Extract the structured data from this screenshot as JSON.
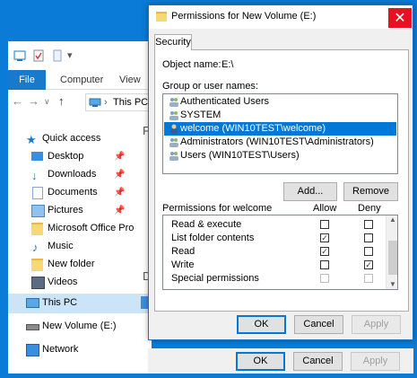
{
  "explorer": {
    "ribbon_tabs": [
      "File",
      "Computer",
      "View"
    ],
    "address": "This PC",
    "partial_headers": [
      "F",
      "D"
    ],
    "sidebar": [
      {
        "label": "Quick access",
        "icon": "star-icon",
        "pinned": false
      },
      {
        "label": "Desktop",
        "icon": "desktop-folder-icon",
        "pinned": true
      },
      {
        "label": "Downloads",
        "icon": "download-arrow-icon",
        "pinned": true
      },
      {
        "label": "Documents",
        "icon": "document-icon",
        "pinned": true
      },
      {
        "label": "Pictures",
        "icon": "pictures-icon",
        "pinned": true
      },
      {
        "label": "Microsoft Office Pro",
        "icon": "folder-icon",
        "pinned": false
      },
      {
        "label": "Music",
        "icon": "music-icon",
        "pinned": false
      },
      {
        "label": "New folder",
        "icon": "folder-icon",
        "pinned": false
      },
      {
        "label": "Videos",
        "icon": "video-icon",
        "pinned": false
      },
      {
        "label": "This PC",
        "icon": "computer-icon",
        "pinned": false
      },
      {
        "label": "New Volume (E:)",
        "icon": "drive-icon",
        "pinned": false
      },
      {
        "label": "Network",
        "icon": "network-icon",
        "pinned": false
      }
    ]
  },
  "dialog": {
    "title": "Permissions for New Volume (E:)",
    "close_glyph": "✕",
    "tab": "Security",
    "object_name_label": "Object name:",
    "object_name_value": "E:\\",
    "group_label": "Group or user names:",
    "users": [
      {
        "label": "Authenticated Users",
        "selected": false
      },
      {
        "label": "SYSTEM",
        "selected": false
      },
      {
        "label": "welcome (WIN10TEST\\welcome)",
        "selected": true
      },
      {
        "label": "Administrators (WIN10TEST\\Administrators)",
        "selected": false
      },
      {
        "label": "Users (WIN10TEST\\Users)",
        "selected": false
      }
    ],
    "add_button": "Add...",
    "remove_button": "Remove",
    "permissions_label": "Permissions for welcome",
    "allow_label": "Allow",
    "deny_label": "Deny",
    "permissions": [
      {
        "name": "Read & execute",
        "allow": false,
        "deny": false,
        "disabled": false
      },
      {
        "name": "List folder contents",
        "allow": true,
        "deny": false,
        "disabled": false
      },
      {
        "name": "Read",
        "allow": true,
        "deny": false,
        "disabled": false
      },
      {
        "name": "Write",
        "allow": false,
        "deny": true,
        "disabled": false
      },
      {
        "name": "Special permissions",
        "allow": false,
        "deny": false,
        "disabled": true
      }
    ],
    "ok_button": "OK",
    "cancel_button": "Cancel",
    "apply_button": "Apply"
  },
  "behind": {
    "ok_button": "OK",
    "cancel_button": "Cancel",
    "apply_button": "Apply"
  },
  "colors": {
    "accent": "#0078d7",
    "close": "#e81123",
    "desktop": "#0a7bd6",
    "selected_row": "#cce4f7"
  }
}
